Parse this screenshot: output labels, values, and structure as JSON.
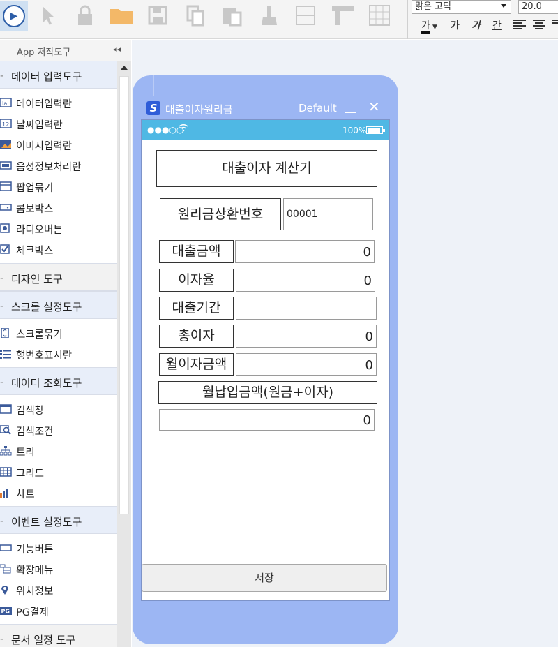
{
  "toolbar": {
    "font_name": "맑은 고딕",
    "font_size": "20.0",
    "format_glyphs": [
      "가",
      "가",
      "가",
      "간"
    ]
  },
  "left_panel": {
    "title": "App 저작도구",
    "collapse_glyph": "◂◂",
    "categories": [
      {
        "label": "데이터 입력도구"
      },
      {
        "label": "디자인 도구"
      },
      {
        "label": "스크롤 설정도구"
      },
      {
        "label": "데이터 조회도구"
      },
      {
        "label": "이벤트 설정도구"
      },
      {
        "label": "문서 일정 도구"
      }
    ],
    "items": [
      {
        "label": "데이터입력란"
      },
      {
        "label": "날짜입력란"
      },
      {
        "label": "이미지입력란"
      },
      {
        "label": "음성정보처리란"
      },
      {
        "label": "팝업묶기"
      },
      {
        "label": "콤보박스"
      },
      {
        "label": "라디오버튼"
      },
      {
        "label": "체크박스"
      },
      {
        "label": "스크롤묶기"
      },
      {
        "label": "행번호표시란"
      },
      {
        "label": "검색창"
      },
      {
        "label": "검색조건"
      },
      {
        "label": "트리"
      },
      {
        "label": "그리드"
      },
      {
        "label": "차트"
      },
      {
        "label": "기능버튼"
      },
      {
        "label": "확장메뉴"
      },
      {
        "label": "위치정보"
      },
      {
        "label": "PG결제"
      }
    ]
  },
  "app": {
    "title": "대출이자원리금",
    "theme": "Default",
    "logo_letter": "S",
    "status_signal": "●●●○○",
    "status_battery": "100%",
    "form": {
      "header": "대출이자 계산기",
      "contract_label": "원리금상환번호",
      "contract_value": "00001",
      "loan_amount_label": "대출금액",
      "loan_amount_value": "0",
      "interest_rate_label": "이자율",
      "interest_rate_value": "0",
      "loan_period_label": "대출기간",
      "loan_period_value": "",
      "total_interest_label": "총이자",
      "total_interest_value": "0",
      "monthly_interest_label": "월이자금액",
      "monthly_interest_value": "0",
      "monthly_payment_label": "월납입금액(원금+이자)",
      "monthly_payment_value": "0"
    },
    "save_label": "저장"
  },
  "colors": {
    "phone_frame": "#9cb6f3",
    "status_bar": "#4fb8e4",
    "category_bg": "#e8eef9"
  }
}
